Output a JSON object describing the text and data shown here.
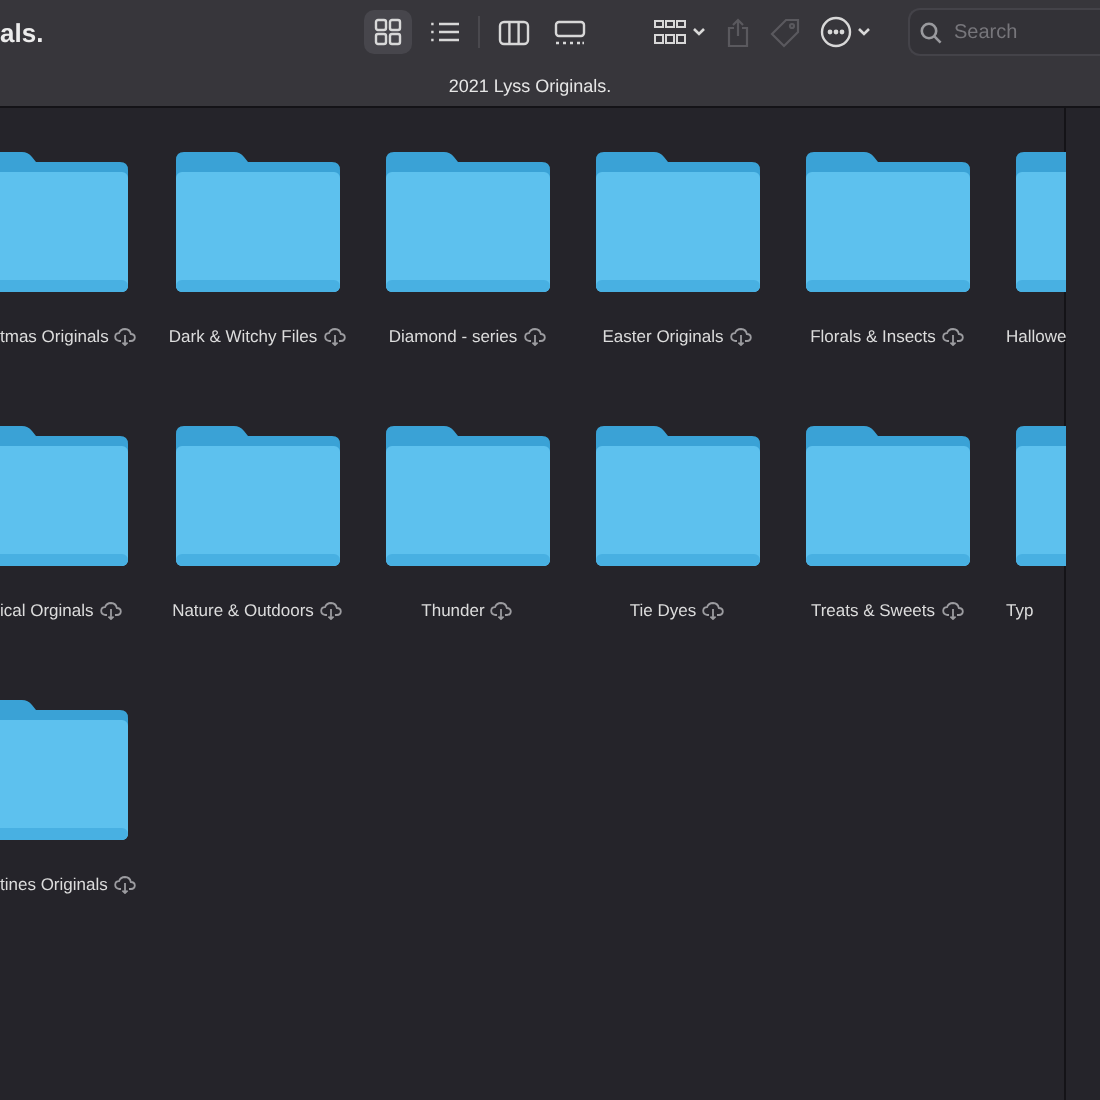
{
  "window": {
    "title": "als."
  },
  "toolbar": {
    "view_modes": [
      {
        "kind": "icons",
        "selected": true
      },
      {
        "kind": "list",
        "selected": false
      },
      {
        "kind": "columns",
        "selected": false
      },
      {
        "kind": "gallery",
        "selected": false
      }
    ],
    "actions": [
      {
        "kind": "group",
        "disabled": false
      },
      {
        "kind": "share",
        "disabled": true
      },
      {
        "kind": "tag",
        "disabled": true
      },
      {
        "kind": "more",
        "disabled": false
      }
    ],
    "search": {
      "placeholder": "Search"
    }
  },
  "path_bar": {
    "title": "2021 Lyss Originals."
  },
  "folders": [
    {
      "name": "tmas Originals",
      "icloud": true
    },
    {
      "name": "Dark & Witchy Files",
      "icloud": true
    },
    {
      "name": "Diamond - series",
      "icloud": true
    },
    {
      "name": "Easter Originals",
      "icloud": true
    },
    {
      "name": "Florals & Insects",
      "icloud": true
    },
    {
      "name": "Hallowe",
      "icloud": false
    },
    {
      "name": "ical Orginals",
      "icloud": true
    },
    {
      "name": "Nature & Outdoors",
      "icloud": true
    },
    {
      "name": "Thunder",
      "icloud": true
    },
    {
      "name": "Tie Dyes",
      "icloud": true
    },
    {
      "name": "Treats & Sweets",
      "icloud": true
    },
    {
      "name": "Typ",
      "icloud": false
    },
    {
      "name": "tines Originals",
      "icloud": true
    }
  ]
}
